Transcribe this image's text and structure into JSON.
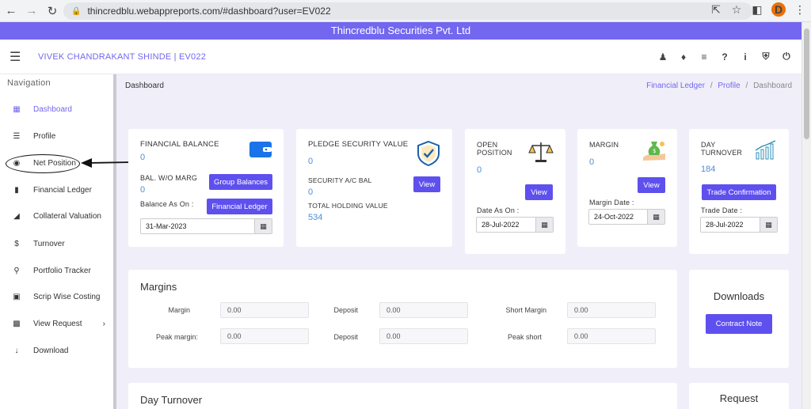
{
  "browser": {
    "url": "thincredblu.webappreports.com/#dashboard?user=EV022",
    "profile_initial": "D"
  },
  "app": {
    "company_title": "Thincredblu Securities Pvt. Ltd",
    "user_name": "VIVEK CHANDRAKANT SHINDE | EV022"
  },
  "sidebar": {
    "title": "Navigation",
    "items": [
      {
        "label": "Dashboard",
        "icon": "dashboard-icon"
      },
      {
        "label": "Profile",
        "icon": "list-icon"
      },
      {
        "label": "Net Position",
        "icon": "circle-icon"
      },
      {
        "label": "Financial Ledger",
        "icon": "book-icon"
      },
      {
        "label": "Collateral Valuation",
        "icon": "area-chart-icon"
      },
      {
        "label": "Turnover",
        "icon": "dollar-icon"
      },
      {
        "label": "Portfolio Tracker",
        "icon": "map-pin-icon"
      },
      {
        "label": "Scrip Wise Costing",
        "icon": "coins-icon"
      },
      {
        "label": "View Request",
        "icon": "grid-icon"
      },
      {
        "label": "Download",
        "icon": "arrow-down-icon"
      }
    ]
  },
  "breadcrumb": {
    "title": "Dashboard",
    "link1": "Financial Ledger",
    "link2": "Profile",
    "current": "Dashboard",
    "sep": "/"
  },
  "cards": {
    "financial_balance": {
      "title": "FINANCIAL BALANCE",
      "value": "0",
      "sub_label": "BAL. W/O MARG",
      "sub_value": "0",
      "balance_as_on": "Balance As On :",
      "date": "31-Mar-2023",
      "btn_group": "Group Balances",
      "btn_ledger": "Financial Ledger"
    },
    "pledge": {
      "title": "PLEDGE SECURITY VALUE",
      "value": "0",
      "sec_label": "SECURITY A/C BAL",
      "sec_value": "0",
      "total_label": "TOTAL HOLDING VALUE",
      "total_value": "534",
      "btn_view": "View"
    },
    "open_position": {
      "title1": "OPEN",
      "title2": "POSITION",
      "value": "0",
      "btn_view": "View",
      "date_label": "Date As On :",
      "date": "28-Jul-2022"
    },
    "margin": {
      "title": "MARGIN",
      "value": "0",
      "btn_view": "View",
      "date_label": "Margin Date :",
      "date": "24-Oct-2022"
    },
    "day_turnover": {
      "title1": "DAY",
      "title2": "TURNOVER",
      "value": "184",
      "btn": "Trade Confirmation",
      "date_label": "Trade Date :",
      "date": "28-Jul-2022"
    }
  },
  "margins": {
    "title": "Margins",
    "fields": [
      {
        "label": "Margin",
        "value": "0.00"
      },
      {
        "label": "Deposit",
        "value": "0.00"
      },
      {
        "label": "Short Margin",
        "value": "0.00"
      },
      {
        "label": "Peak margin:",
        "value": "0.00"
      },
      {
        "label": "Deposit",
        "value": "0.00"
      },
      {
        "label": "Peak short",
        "value": "0.00"
      }
    ]
  },
  "downloads": {
    "title": "Downloads",
    "btn": "Contract Note"
  },
  "day_turnover_section": {
    "title": "Day Turnover"
  },
  "request": {
    "title": "Request"
  },
  "colors": {
    "accent": "#7367f0",
    "button": "#5e50ee",
    "value_blue": "#4a90d9"
  }
}
